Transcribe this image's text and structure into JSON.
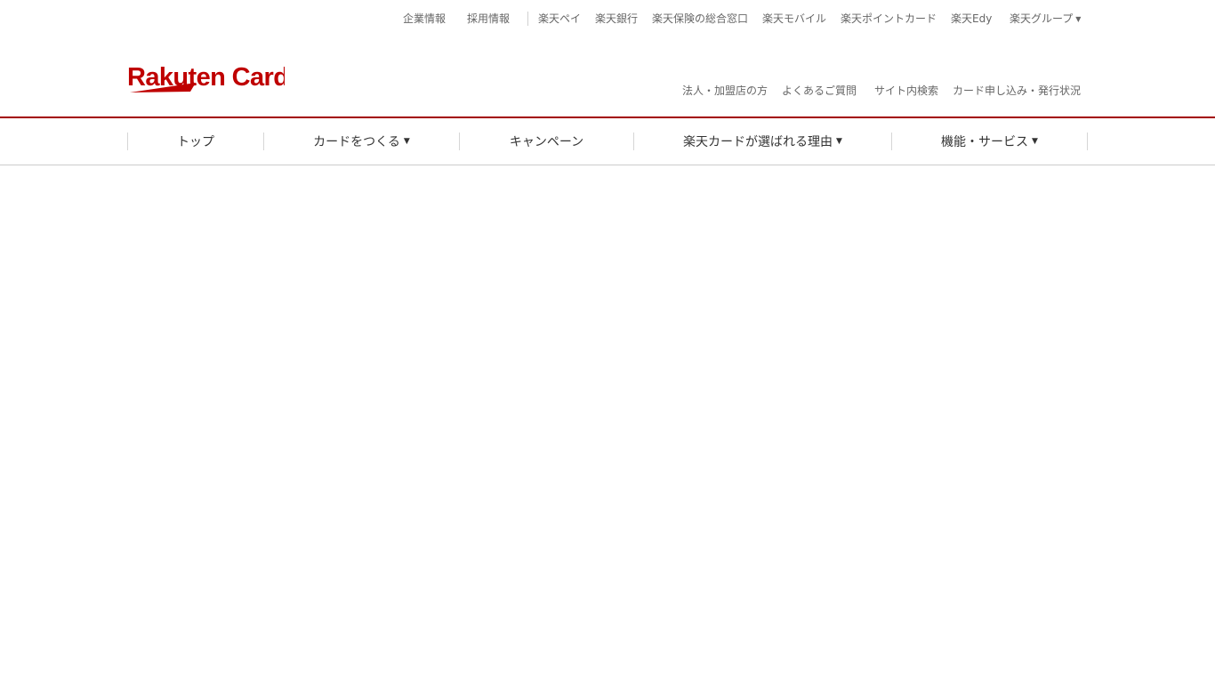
{
  "top_links": {
    "company_info": "企業情報",
    "recruit_info": "採用情報",
    "rakuten_pay": "楽天ペイ",
    "rakuten_bank": "楽天銀行",
    "rakuten_insurance": "楽天保険の総合窓口",
    "rakuten_mobile": "楽天モバイル",
    "rakuten_point_card": "楽天ポイントカード",
    "rakuten_edy": "楽天Edy",
    "rakuten_group": "楽天グループ"
  },
  "logo": {
    "text": "Rakuten Card",
    "color": "#bf0000"
  },
  "sub_links": {
    "corporate": "法人・加盟店の方",
    "faq": "よくあるご質問",
    "site_search": "サイト内検索",
    "application_status": "カード申し込み・発行状況"
  },
  "main_nav": {
    "top": "トップ",
    "make_card": "カードをつくる",
    "campaign": "キャンペーン",
    "reasons": "楽天カードが選ばれる理由",
    "features": "機能・サービス"
  },
  "colors": {
    "accent_red": "#a20000",
    "logo_red": "#bf0000"
  }
}
